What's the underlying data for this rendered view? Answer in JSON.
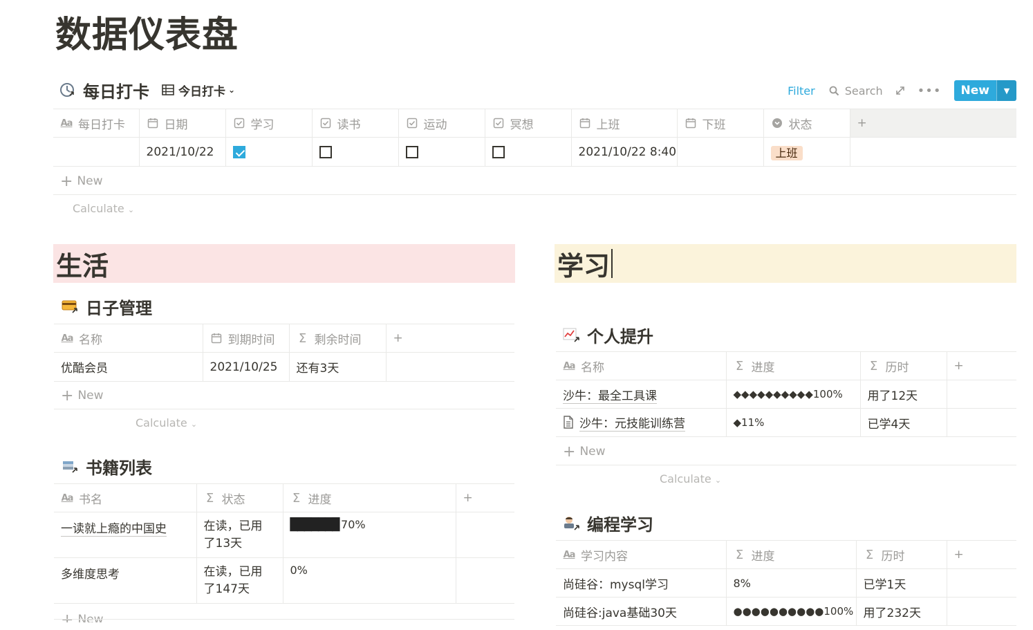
{
  "page": {
    "title": "数据仪表盘"
  },
  "checkin": {
    "title": "每日打卡",
    "view": "今日打卡",
    "toolbar": {
      "filter": "Filter",
      "search": "Search",
      "new": "New"
    },
    "columns": [
      "每日打卡",
      "日期",
      "学习",
      "读书",
      "运动",
      "冥想",
      "上班",
      "下班",
      "状态"
    ],
    "row": {
      "name": "",
      "date": "2021/10/22",
      "study": true,
      "read": false,
      "exercise": false,
      "meditate": false,
      "clock_in": "2021/10/22 8:40",
      "clock_out": "",
      "status": "上班"
    },
    "new_label": "New",
    "calc_label": "Calculate"
  },
  "life": {
    "heading": "生活",
    "days": {
      "title": "日子管理",
      "columns": [
        "名称",
        "到期时间",
        "剩余时间"
      ],
      "rows": [
        {
          "name": "优酷会员",
          "due": "2021/10/25",
          "remain": "还有3天"
        }
      ],
      "new_label": "New",
      "calc_label": "Calculate"
    },
    "books": {
      "title": "书籍列表",
      "columns": [
        "书名",
        "状态",
        "进度"
      ],
      "rows": [
        {
          "name": "一读就上瘾的中国史",
          "status_l1": "在读，已用",
          "status_l2": "了13天",
          "bar": "▉▉▉▉▉▉▉",
          "pct": "70%",
          "progress": 0.7
        },
        {
          "name": "多维度思考",
          "status_l1": "在读，已用",
          "status_l2": "了147天",
          "bar": "",
          "pct": "0%",
          "progress": 0
        }
      ],
      "new_label": "New"
    }
  },
  "study": {
    "heading": "学习",
    "improve": {
      "title": "个人提升",
      "columns": [
        "名称",
        "进度",
        "历时"
      ],
      "rows": [
        {
          "name": "沙牛：最全工具课",
          "progress": "◆◆◆◆◆◆◆◆◆◆100%",
          "elapsed": "用了12天"
        },
        {
          "name": "沙牛：元技能训练营",
          "progress": "◆11%",
          "elapsed": "已学4天"
        }
      ],
      "new_label": "New",
      "calc_label": "Calculate"
    },
    "coding": {
      "title": "编程学习",
      "columns": [
        "学习内容",
        "进度",
        "历时"
      ],
      "rows": [
        {
          "name": "尚硅谷：mysql学习",
          "progress": "8%",
          "elapsed": "已学1天"
        },
        {
          "name": "尚硅谷:java基础30天",
          "progress": "●●●●●●●●●●100%",
          "elapsed": "用了232天"
        }
      ]
    }
  },
  "colors": {
    "accent": "#2eaadc",
    "life_band": "#fbe4e4",
    "study_band": "#fbf3db",
    "tag_bg": "#fadec9"
  }
}
